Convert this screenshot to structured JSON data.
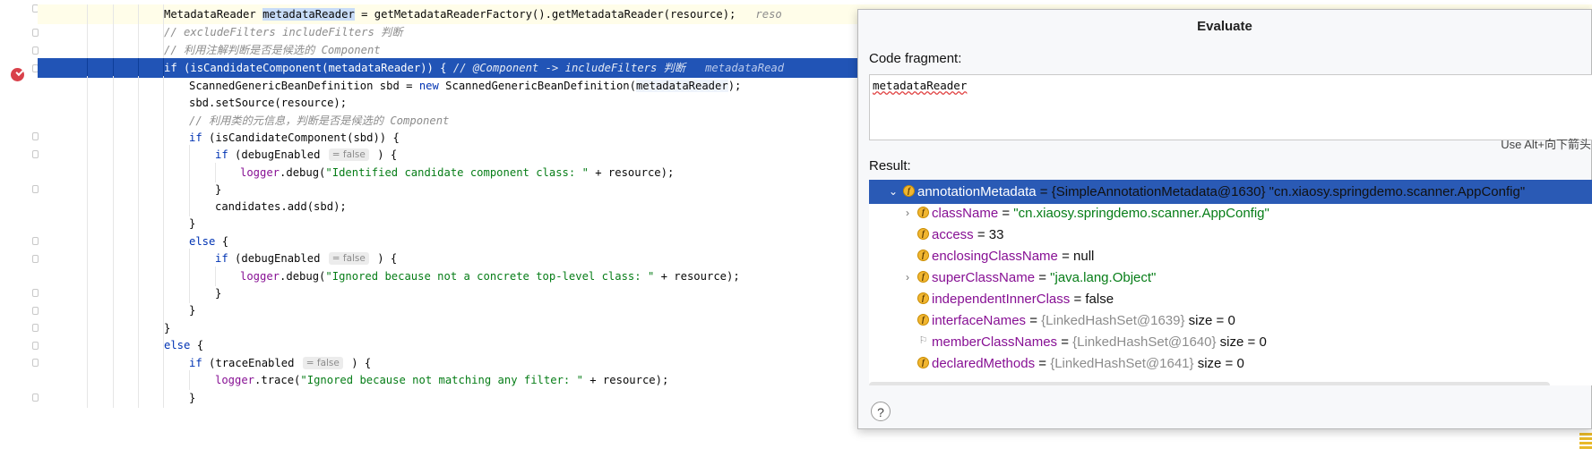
{
  "editor": {
    "lines": [
      {
        "segments": [
          [
            "",
            "MetadataReader "
          ],
          [
            "selword",
            "metadataReader"
          ],
          [
            "",
            " = getMetadataReaderFactory().getMetadataReader(resource);   "
          ],
          [
            "iv",
            "reso"
          ]
        ]
      },
      {
        "segments": [
          [
            "cm",
            "// excludeFilters includeFilters 判断"
          ]
        ]
      },
      {
        "segments": [
          [
            "cm",
            "// 利用注解判断是否是候选的 Component"
          ]
        ]
      },
      {
        "segments": [
          [
            "kw",
            "if"
          ],
          [
            "",
            " (isCandidateComponent(metadataReader)) { "
          ],
          [
            "cm",
            "// @Component -> includeFilters 判断   "
          ],
          [
            "iv",
            "metadataRead"
          ]
        ]
      },
      {
        "segments": [
          [
            "",
            "ScannedGenericBeanDefinition sbd = "
          ],
          [
            "kw",
            "new"
          ],
          [
            "",
            " ScannedGenericBeanDefinition("
          ],
          [
            "usage",
            "metadataReader"
          ],
          [
            "",
            "); "
          ]
        ]
      },
      {
        "segments": [
          [
            "",
            "sbd.setSource(resource);"
          ]
        ]
      },
      {
        "segments": [
          [
            "cm",
            "// 利用类的元信息，判断是否是候选的 Component"
          ]
        ]
      },
      {
        "segments": [
          [
            "kw",
            "if"
          ],
          [
            "",
            " (isCandidateComponent(sbd)) {"
          ]
        ]
      },
      {
        "segments": [
          [
            "kw",
            "if"
          ],
          [
            "",
            " (debugEnabled "
          ],
          [
            "hint",
            "= false"
          ],
          [
            "",
            " ) {"
          ]
        ]
      },
      {
        "segments": [
          [
            "field",
            "logger"
          ],
          [
            "",
            ".debug("
          ],
          [
            "str",
            "\"Identified candidate component class: \""
          ],
          [
            "",
            " + resource);"
          ]
        ]
      },
      {
        "segments": [
          [
            "",
            "}"
          ]
        ]
      },
      {
        "segments": [
          [
            "",
            "candidates.add(sbd);"
          ]
        ]
      },
      {
        "segments": [
          [
            "",
            "}"
          ]
        ]
      },
      {
        "segments": [
          [
            "kw",
            "else"
          ],
          [
            "",
            " {"
          ]
        ]
      },
      {
        "segments": [
          [
            "kw",
            "if"
          ],
          [
            "",
            " (debugEnabled "
          ],
          [
            "hint",
            "= false"
          ],
          [
            "",
            " ) {"
          ]
        ]
      },
      {
        "segments": [
          [
            "field",
            "logger"
          ],
          [
            "",
            ".debug("
          ],
          [
            "str",
            "\"Ignored because not a concrete top-level class: \""
          ],
          [
            "",
            " + resource);"
          ]
        ]
      },
      {
        "segments": [
          [
            "",
            "}"
          ]
        ]
      },
      {
        "segments": [
          [
            "",
            "}"
          ]
        ]
      },
      {
        "segments": [
          [
            "",
            "}"
          ]
        ]
      },
      {
        "segments": [
          [
            "kw",
            "else"
          ],
          [
            "",
            " {"
          ]
        ]
      },
      {
        "segments": [
          [
            "kw",
            "if"
          ],
          [
            "",
            " (traceEnabled "
          ],
          [
            "hint",
            "= false"
          ],
          [
            "",
            " ) {"
          ]
        ]
      },
      {
        "segments": [
          [
            "field",
            "logger"
          ],
          [
            "",
            ".trace("
          ],
          [
            "str",
            "\"Ignored because not matching any filter: \""
          ],
          [
            "",
            " + resource);"
          ]
        ]
      },
      {
        "segments": [
          [
            "",
            "}"
          ]
        ]
      }
    ]
  },
  "dialog": {
    "title": "Evaluate",
    "code_label": "Code fragment:",
    "code_value": "metadataReader",
    "hint": "Use Alt+向下箭头",
    "result_label": "Result:",
    "help": "?",
    "rows": [
      {
        "chevron": "⌄",
        "icon": "f",
        "name": "annotationMetadata",
        "eq": " = ",
        "value": "{SimpleAnnotationMetadata@1630} \"cn.xiaosy.springdemo.scanner.AppConfig\"",
        "value_class": "v-eq",
        "size": ""
      },
      {
        "chevron": "›",
        "icon": "f",
        "name": "className",
        "eq": " = ",
        "value": "\"cn.xiaosy.springdemo.scanner.AppConfig\"",
        "value_class": "v-str",
        "size": ""
      },
      {
        "chevron": "",
        "icon": "f",
        "name": "access",
        "eq": " = ",
        "value": "33",
        "value_class": "v-eq",
        "size": ""
      },
      {
        "chevron": "",
        "icon": "f",
        "name": "enclosingClassName",
        "eq": " = ",
        "value": "null",
        "value_class": "v-eq",
        "size": ""
      },
      {
        "chevron": "›",
        "icon": "f",
        "name": "superClassName",
        "eq": " = ",
        "value": "\"java.lang.Object\"",
        "value_class": "v-str",
        "size": ""
      },
      {
        "chevron": "",
        "icon": "f",
        "name": "independentInnerClass",
        "eq": " = ",
        "value": "false",
        "value_class": "v-eq",
        "size": ""
      },
      {
        "chevron": "",
        "icon": "f",
        "name": "interfaceNames",
        "eq": " = ",
        "value": "{LinkedHashSet@1639}",
        "value_class": "v-ref",
        "size": " size = 0"
      },
      {
        "chevron": "",
        "icon": "flag",
        "name": "memberClassNames",
        "eq": " = ",
        "value": "{LinkedHashSet@1640}",
        "value_class": "v-ref",
        "size": " size = 0"
      },
      {
        "chevron": "",
        "icon": "f",
        "name": "declaredMethods",
        "eq": " = ",
        "value": "{LinkedHashSet@1641}",
        "value_class": "v-ref",
        "size": " size = 0"
      }
    ]
  },
  "colors": {
    "execution_line": "#2154b6",
    "selected_row": "#2a5ab5",
    "keyword": "#0033b3",
    "string": "#067d17",
    "field": "#871094",
    "breakpoint": "#d9414a"
  }
}
